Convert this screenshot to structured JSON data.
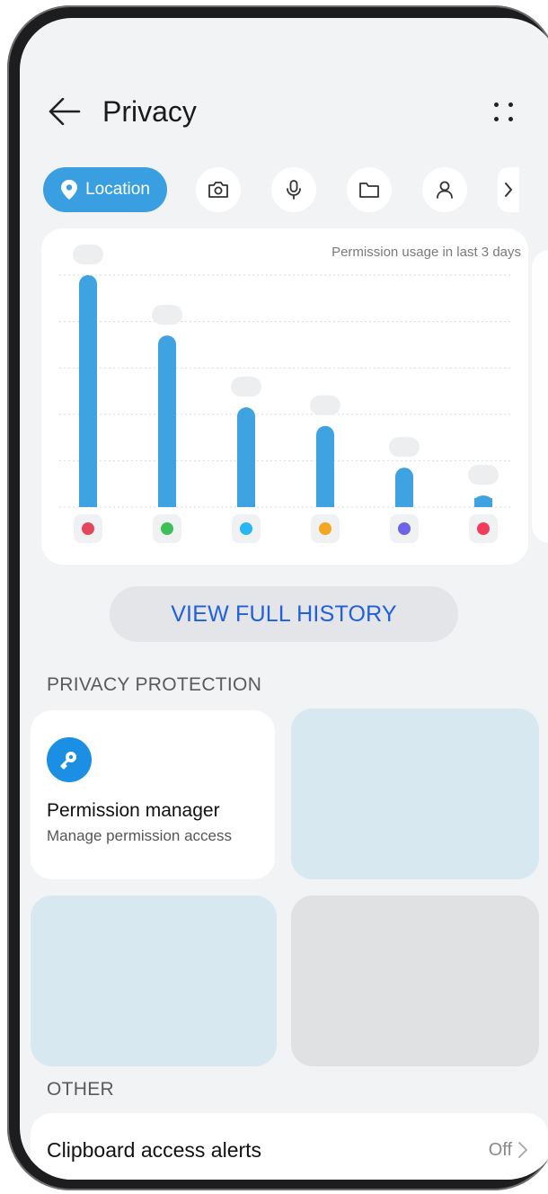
{
  "header": {
    "title": "Privacy",
    "back_icon": "arrow-left-icon",
    "more_icon": "more-dots-icon"
  },
  "tabs": [
    {
      "label": "Location",
      "icon": "location-pin-icon",
      "active": true
    },
    {
      "label": "",
      "icon": "camera-icon"
    },
    {
      "label": "",
      "icon": "microphone-icon"
    },
    {
      "label": "",
      "icon": "folder-icon"
    },
    {
      "label": "",
      "icon": "contacts-icon"
    },
    {
      "label": "",
      "icon": "chevron-right-icon"
    }
  ],
  "usage_chart": {
    "caption": "Permission usage in last 3 days",
    "bar_color": "#3ea3e0",
    "apps": [
      {
        "icon": "maps-pin-icon",
        "color": "#e5455b",
        "value": 100
      },
      {
        "icon": "people-icon",
        "color": "#3fbf5a",
        "value": 74
      },
      {
        "icon": "chat-icon",
        "color": "#29b6f6",
        "value": 43
      },
      {
        "icon": "weather-icon",
        "color": "#f5a623",
        "value": 35
      },
      {
        "icon": "video-icon",
        "color": "#6c63e8",
        "value": 17
      },
      {
        "icon": "shopping-cart-icon",
        "color": "#ef3e5c",
        "value": 5
      }
    ]
  },
  "history_button": {
    "label": "VIEW FULL HISTORY",
    "color": "#1f5fe0"
  },
  "privacy_protection": {
    "header": "PRIVACY PROTECTION",
    "permission_manager": {
      "title": "Permission manager",
      "subtitle": "Manage permission access",
      "icon": "key-icon"
    }
  },
  "other": {
    "header": "OTHER",
    "clipboard": {
      "label": "Clipboard access alerts",
      "value": "Off"
    }
  }
}
